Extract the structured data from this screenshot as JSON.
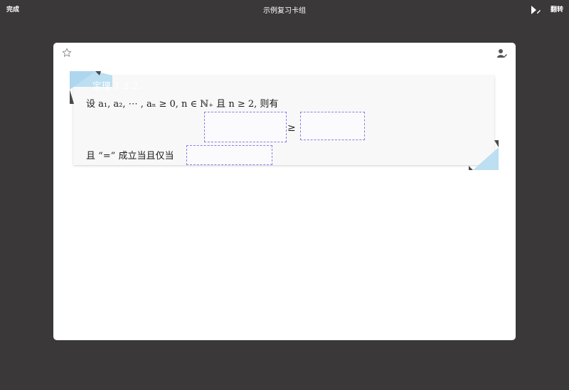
{
  "topbar": {
    "done_label": "完成",
    "title": "示例复习卡组",
    "edit_icon": "pen-icon",
    "flip_label": "翻转"
  },
  "card": {
    "star_icon": "star-outline-icon",
    "user_icon": "user-edit-icon",
    "theorem": {
      "label": "定理 1.2.2.",
      "line1": "设 a₁, a₂, ⋯ , aₙ ≥ 0, n ∈ ℕ₊ 且 n ≥ 2, 则有",
      "relation": "≥",
      "line3": "且 “=” 成立当且仅当"
    },
    "blanks": [
      "",
      "",
      ""
    ]
  },
  "colors": {
    "background": "#3a3839",
    "card": "#ffffff",
    "ribbon": "#bcdff1",
    "blank_border": "#8a7fe0"
  }
}
